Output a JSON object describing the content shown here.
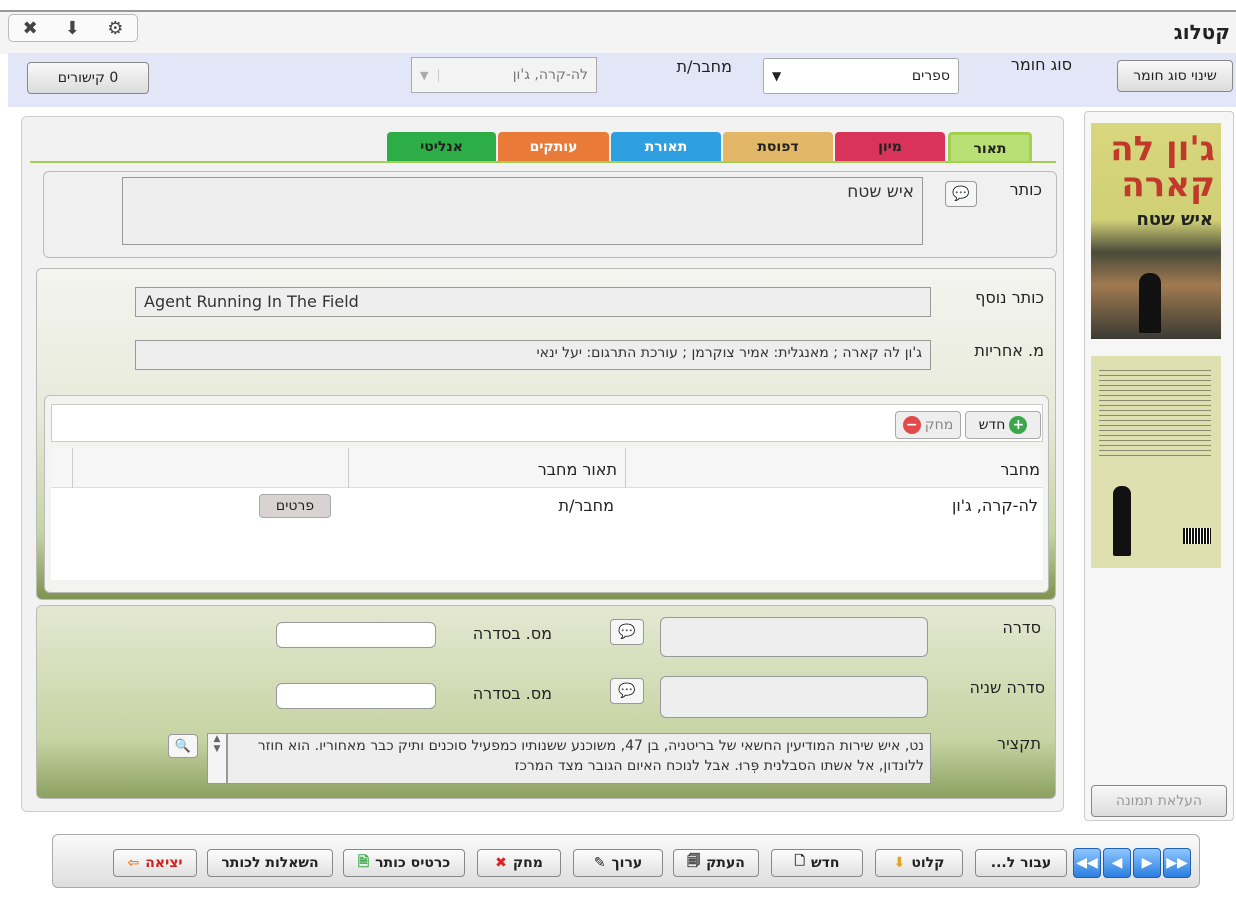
{
  "window": {
    "title": "קטלוג"
  },
  "typebar": {
    "change_type_label": "שינוי סוג חומר",
    "material_type_label": "סוג חומר",
    "material_type_value": "ספרים",
    "author_label": "מחבר/ת",
    "author_value": "לה-קרה, ג'ון",
    "links_label": "0 קישורים"
  },
  "tabs": [
    {
      "label": "תאור",
      "color": "#8cc84b"
    },
    {
      "label": "מיון",
      "color": "#d8335a"
    },
    {
      "label": "דפוסת",
      "color": "#e2b868"
    },
    {
      "label": "תאורת",
      "color": "#2e9fe0"
    },
    {
      "label": "עותקים",
      "color": "#ea7a38"
    },
    {
      "label": "אנליטי",
      "color": "#2cad46"
    }
  ],
  "title_section": {
    "label": "כותר",
    "value": "איש שטח"
  },
  "extra": {
    "subtitle_label": "כותר נוסף",
    "subtitle_value": "Agent Running In The Field",
    "resp_label": "מ. אחריות",
    "resp_value": "ג'ון לה קארה ; מאנגלית: אמיר צוקרמן ; עורכת התרגום: יעל ינאי"
  },
  "authors_table": {
    "new_label": "חדש",
    "delete_label": "מחק",
    "headers": [
      "מחבר",
      "תאור מחבר"
    ],
    "rows": [
      {
        "author": "לה-קרה, ג'ון",
        "role": "מחבר/ת",
        "details": "פרטים"
      }
    ]
  },
  "series": {
    "series_label": "סדרה",
    "series2_label": "סדרה שניה",
    "num_label": "מס. בסדרה",
    "summary_label": "תקציר",
    "summary_value": "נט, איש שירות המודיעין החשאי של בריטניה, בן 47, משוכנע ששנותיו כמפעיל סוכנים ותיק כבר מאחוריו. הוא חוזר ללונדון, אל אשתו הסבלנית פְּרוּ. אבל לנוכח האיום הגובר מצד המרכז"
  },
  "cover": {
    "author_text": "ג'ון לה קארה",
    "title_text": "איש שטח",
    "upload_label": "העלאת תמונה"
  },
  "bottom": {
    "goto_label": "עבור ל...",
    "receive_label": "קלוט",
    "new_label": "חדש",
    "copy_label": "העתק",
    "edit_label": "ערוך",
    "delete_label": "מחק",
    "card_label": "כרטיס כותר",
    "loans_label": "השאלות לכותר",
    "exit_label": "יציאה"
  }
}
